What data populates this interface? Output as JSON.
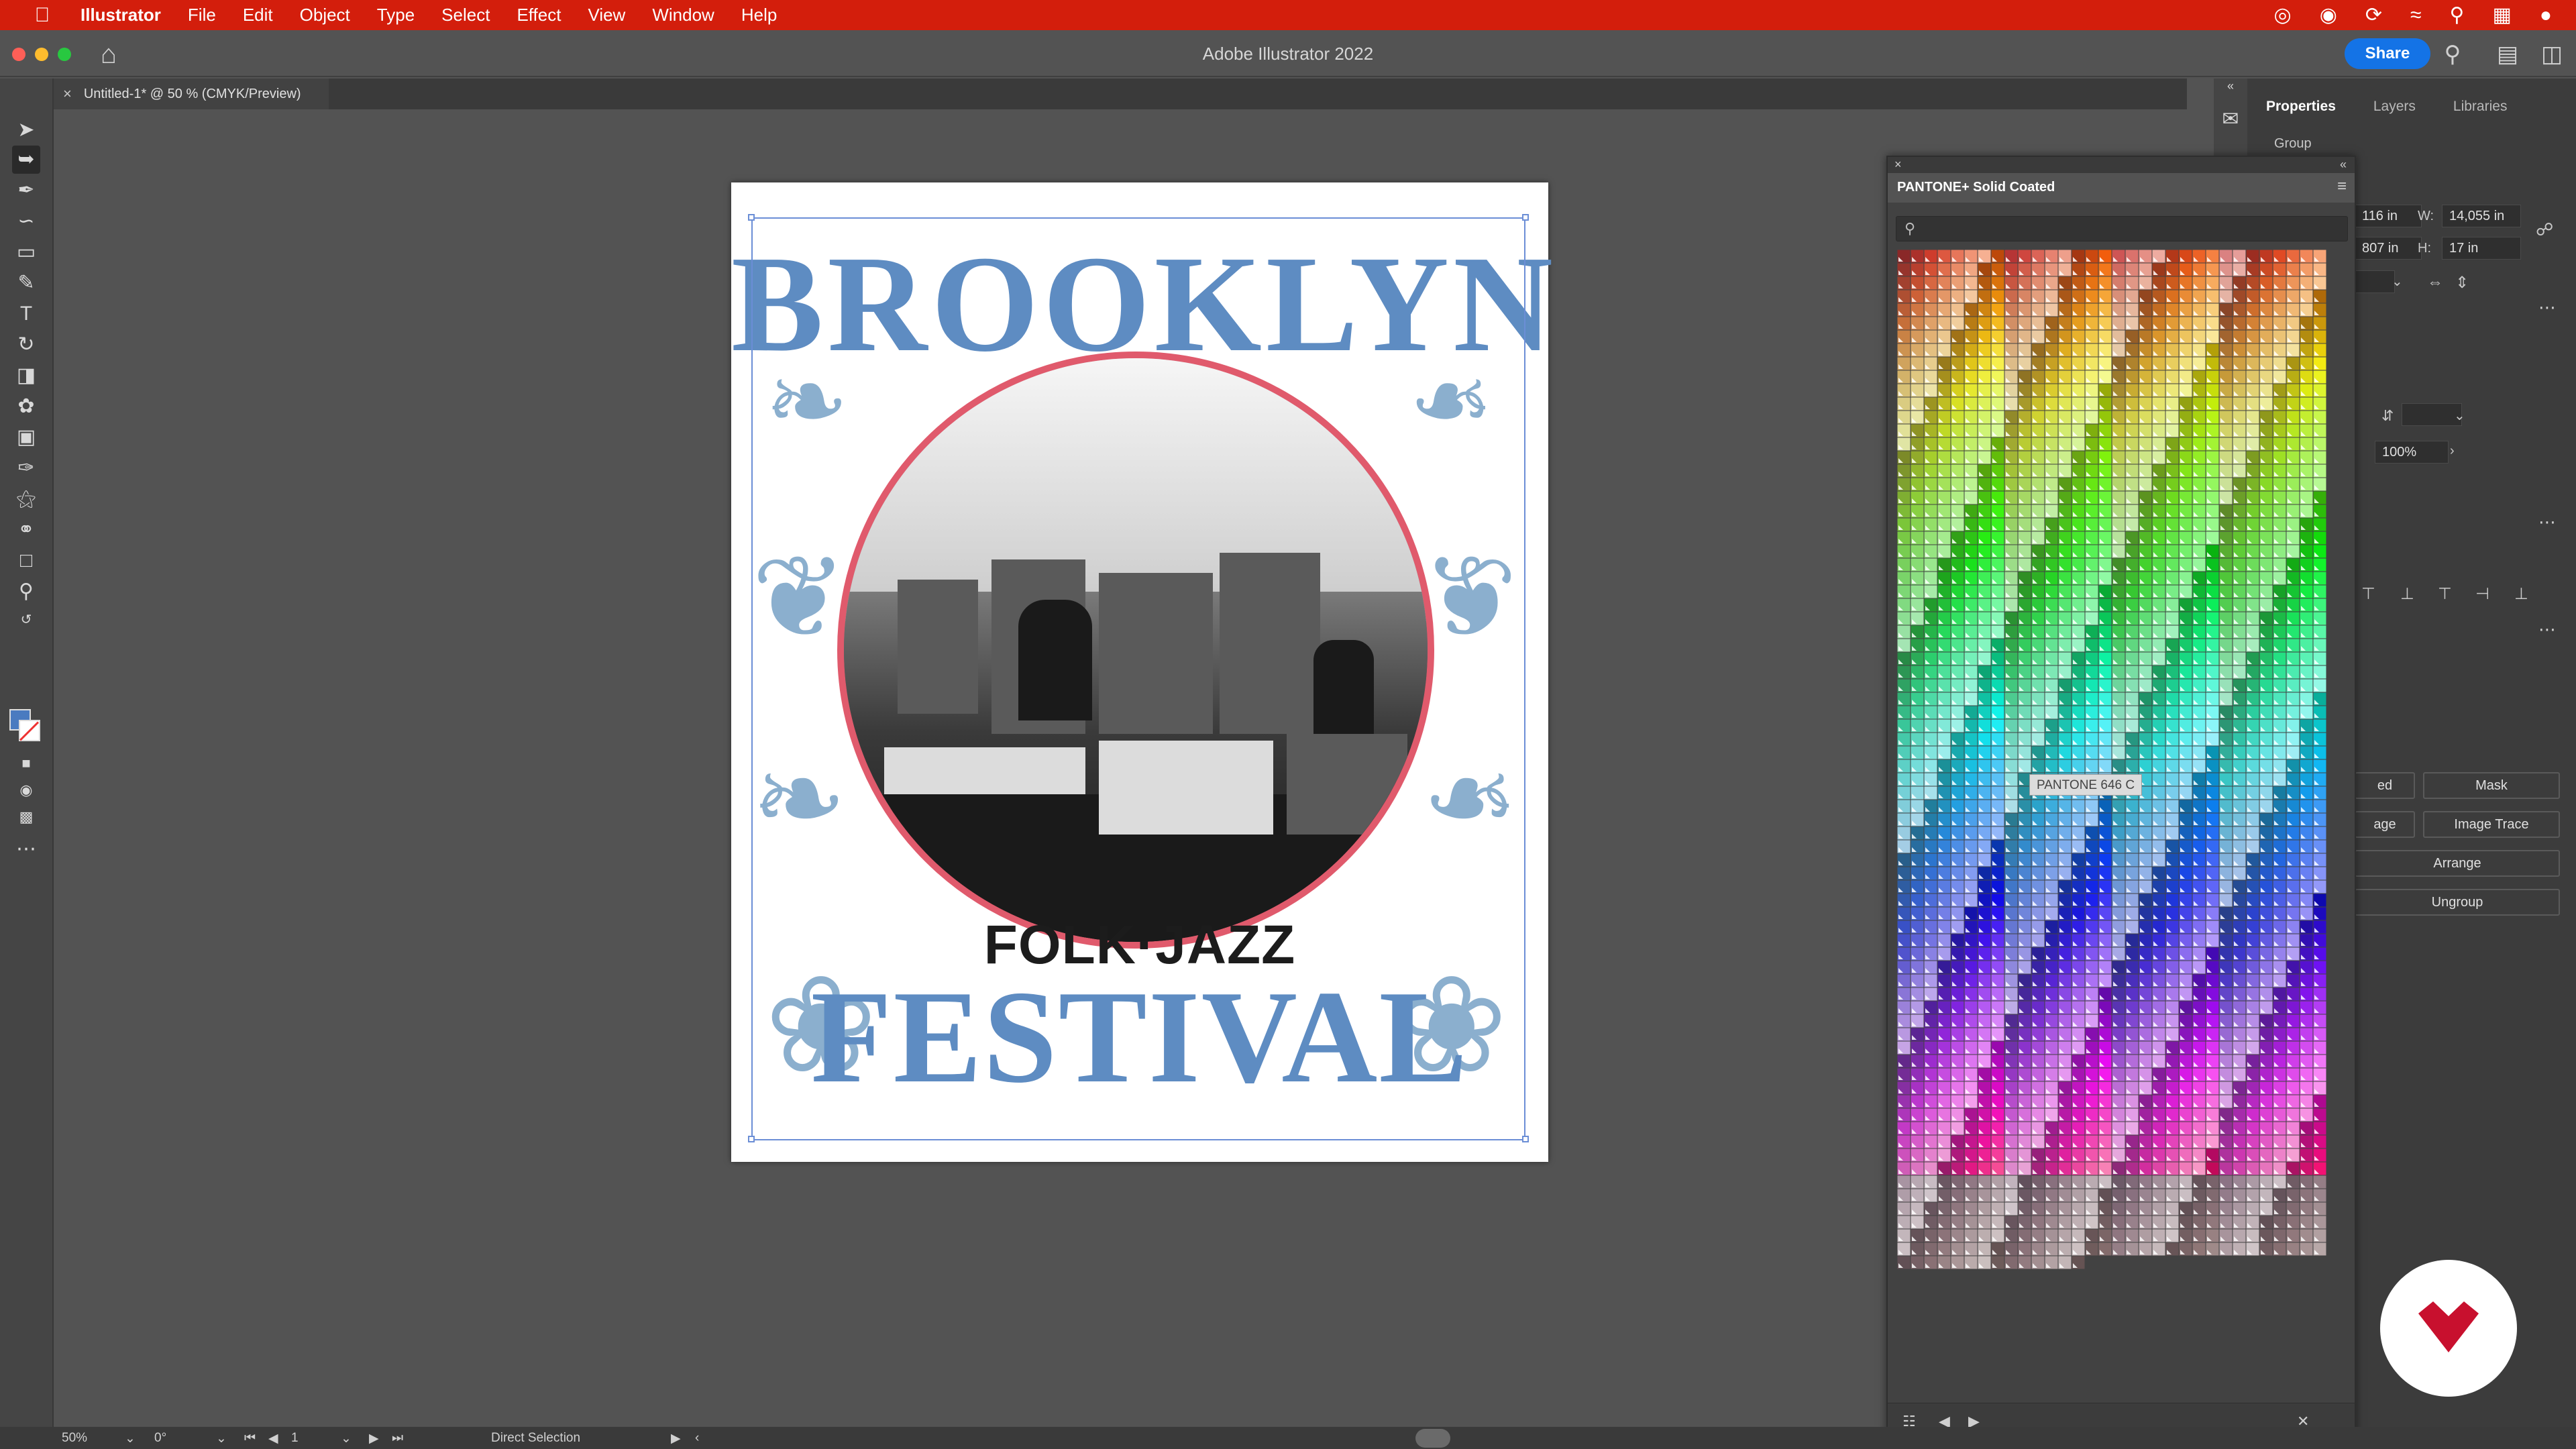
{
  "menubar": {
    "app_name": "Illustrator",
    "items": [
      "File",
      "Edit",
      "Object",
      "Type",
      "Select",
      "Effect",
      "View",
      "Window",
      "Help"
    ]
  },
  "window": {
    "title": "Adobe Illustrator 2022",
    "share_label": "Share",
    "doc_tab": "Untitled-1* @ 50 % (CMYK/Preview)"
  },
  "poster": {
    "title_top": "BROOKLYN",
    "subtitle": "FOLK·JAZZ",
    "title_bottom": "FESTIVAL"
  },
  "properties": {
    "tabs": [
      "Properties",
      "Layers",
      "Libraries"
    ],
    "selection_type": "Group",
    "x_value": "116 in",
    "y_value": "807 in",
    "w_label": "W:",
    "w_value": "14,055 in",
    "h_label": "H:",
    "h_value": "17 in",
    "opacity": "100%",
    "btn_embed": "ed",
    "btn_mask": "Mask",
    "btn_image": "age",
    "btn_image_trace": "Image Trace",
    "btn_arrange": "Arrange",
    "btn_ungroup": "Ungroup"
  },
  "swatches": {
    "title": "PANTONE+ Solid Coated",
    "tooltip": "PANTONE 646 C",
    "colors": {
      "accent": "#1473e6",
      "menubar": "#d31e0c"
    }
  },
  "statusbar": {
    "zoom": "50%",
    "rotation": "0°",
    "artboard": "1",
    "tool": "Direct Selection"
  }
}
